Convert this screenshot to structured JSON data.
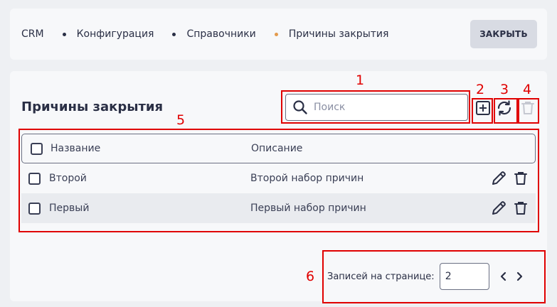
{
  "breadcrumb": {
    "items": [
      "CRM",
      "Конфигурация",
      "Справочники",
      "Причины закрытия"
    ]
  },
  "header": {
    "close_label": "ЗАКРЫТЬ"
  },
  "panel": {
    "title": "Причины закрытия"
  },
  "search": {
    "placeholder": "Поиск",
    "value": ""
  },
  "table": {
    "columns": [
      "Название",
      "Описание"
    ],
    "rows": [
      {
        "name": "Второй",
        "description": "Второй набор причин"
      },
      {
        "name": "Первый",
        "description": "Первый набор причин"
      }
    ]
  },
  "pagination": {
    "label": "Записей на странице:",
    "page_size": "2"
  },
  "annotations": [
    "1",
    "2",
    "3",
    "4",
    "5",
    "6"
  ],
  "colors": {
    "annotation": "#e00000",
    "accent_dot": "#e39a4c",
    "text": "#2a2f45"
  },
  "icons": [
    "search-icon",
    "add-icon",
    "refresh-icon",
    "trash-icon",
    "edit-icon",
    "chevron-left-icon",
    "chevron-right-icon"
  ]
}
